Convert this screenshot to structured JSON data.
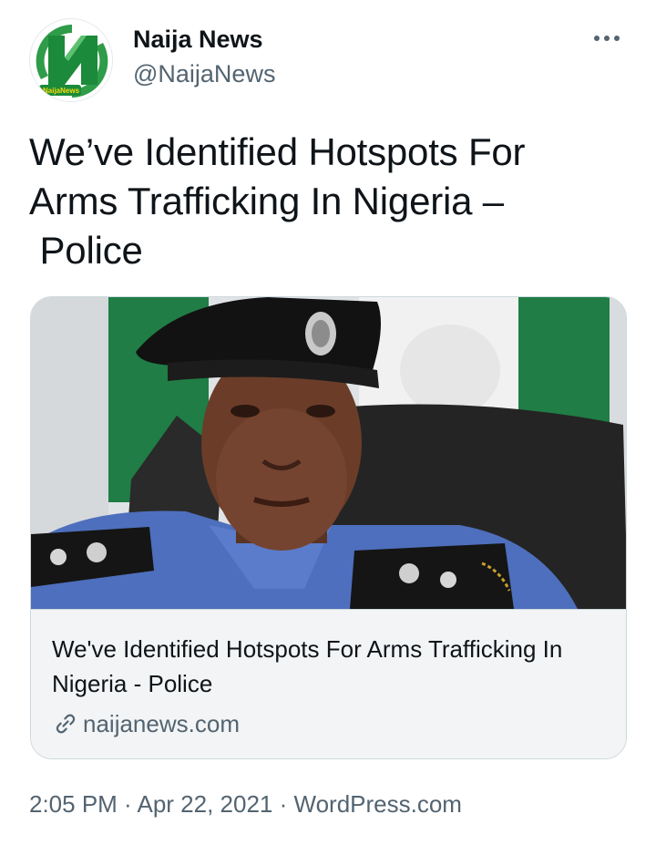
{
  "author": {
    "display_name": "Naija News",
    "handle": "@NaijaNews",
    "avatar_icon": "naija-news-logo",
    "avatar_logo_text": "NaijaNews"
  },
  "more_icon": "more-options-icon",
  "tweet": {
    "text": "We’ve Identified Hotspots For Arms Trafficking In Nigeria –\n Police"
  },
  "card": {
    "image_alt": "Police officer in black beret and blue uniform",
    "title": "We've Identified Hotspots For Arms Trafficking In Nigeria - Police",
    "domain": "naijanews.com",
    "link_icon": "link-icon"
  },
  "meta": {
    "time": "2:05 PM",
    "separator1": " · ",
    "date": "Apr 22, 2021",
    "separator2": " · ",
    "source": "WordPress.com"
  },
  "colors": {
    "brand_green": "#1b8a3a",
    "secondary_text": "#536471",
    "border": "#cfd9de"
  }
}
